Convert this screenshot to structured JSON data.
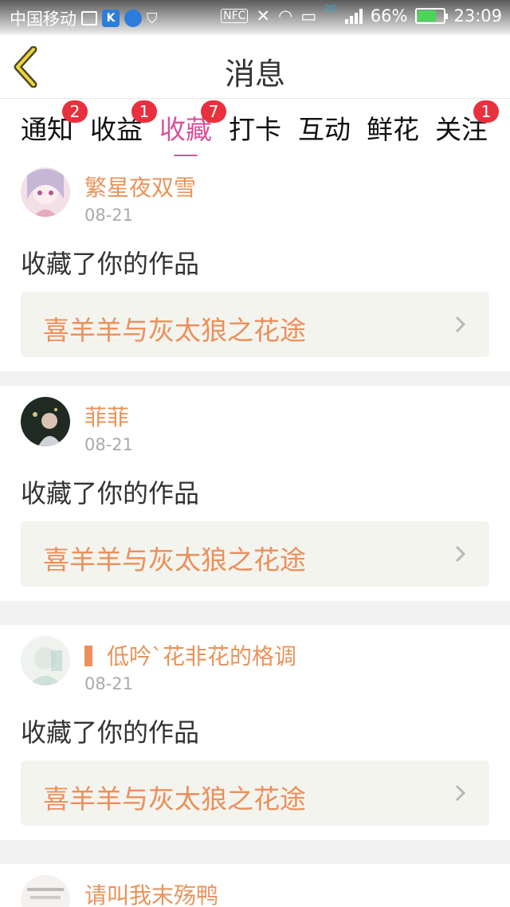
{
  "status_bar": {
    "carrier": "中国移动",
    "network": "2G",
    "battery": "66%",
    "time": "23:09",
    "nfc": "NFC",
    "k_icon": "K"
  },
  "header": {
    "title": "消息"
  },
  "tabs": [
    {
      "label": "通知",
      "badge": "2"
    },
    {
      "label": "收益",
      "badge": "1"
    },
    {
      "label": "收藏",
      "badge": "7",
      "active": true
    },
    {
      "label": "打卡",
      "badge": ""
    },
    {
      "label": "互动",
      "badge": ""
    },
    {
      "label": "鲜花",
      "badge": ""
    },
    {
      "label": "关注",
      "badge": "1"
    }
  ],
  "items": [
    {
      "user": "繁星夜双雪",
      "date": "08-21",
      "action": "收藏了你的作品",
      "work": "喜羊羊与灰太狼之花途"
    },
    {
      "user": "菲菲",
      "date": "08-21",
      "action": "收藏了你的作品",
      "work": "喜羊羊与灰太狼之花途"
    },
    {
      "user": "低吟ˋ花非花的格调",
      "date": "08-21",
      "action": "收藏了你的作品",
      "work": "喜羊羊与灰太狼之花途"
    },
    {
      "user": "请叫我末殇鸭",
      "date": "",
      "action": "",
      "work": ""
    }
  ],
  "colors": {
    "accent": "#d9519b",
    "orange": "#ec8f5a",
    "badge": "#e9303e"
  }
}
